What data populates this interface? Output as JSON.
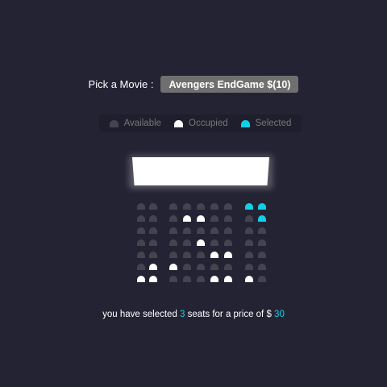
{
  "colors": {
    "background": "#242333",
    "available": "#444451",
    "occupied": "#ffffff",
    "selected": "#0fd0e6"
  },
  "movie_picker": {
    "label": "Pick a Movie :",
    "selected_option": "Avengers EndGame $(10)"
  },
  "legend": {
    "available_label": "Available",
    "occupied_label": "Occupied",
    "selected_label": "Selected"
  },
  "seating": {
    "rows": [
      [
        "A",
        "A",
        "A",
        "A",
        "A",
        "A",
        "A",
        "S"
      ],
      [
        "A",
        "A",
        "A",
        "O",
        "O",
        "A",
        "A",
        "A"
      ],
      [
        "A",
        "A",
        "A",
        "A",
        "A",
        "A",
        "A",
        "A"
      ],
      [
        "A",
        "A",
        "A",
        "A",
        "O",
        "A",
        "A",
        "A"
      ],
      [
        "A",
        "A",
        "A",
        "A",
        "A",
        "O",
        "O",
        "A"
      ],
      [
        "A",
        "O",
        "O",
        "A",
        "A",
        "A",
        "A",
        "A"
      ],
      [
        "O",
        "O",
        "A",
        "A",
        "A",
        "O",
        "O",
        "O"
      ]
    ],
    "extra_selected": [
      [
        0,
        7
      ],
      [
        1,
        7
      ]
    ]
  },
  "summary": {
    "prefix": "you have selected ",
    "count": "3",
    "middle": " seats for a price of $ ",
    "price": "30"
  }
}
